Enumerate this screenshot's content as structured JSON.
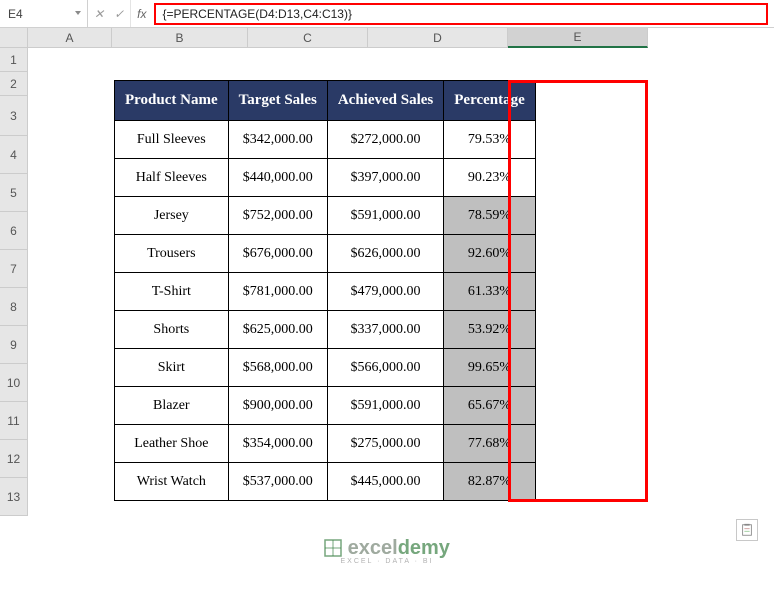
{
  "formula_bar": {
    "cell_ref": "E4",
    "formula": "{=PERCENTAGE(D4:D13,C4:C13)}"
  },
  "columns": [
    "A",
    "B",
    "C",
    "D",
    "E"
  ],
  "rows": [
    "1",
    "2",
    "3",
    "4",
    "5",
    "6",
    "7",
    "8",
    "9",
    "10",
    "11",
    "12",
    "13"
  ],
  "headers": {
    "product": "Product Name",
    "target": "Target Sales",
    "achieved": "Achieved Sales",
    "percentage": "Percentage"
  },
  "data": [
    {
      "product": "Full Sleeves",
      "target": "$342,000.00",
      "achieved": "$272,000.00",
      "pct": "79.53%"
    },
    {
      "product": "Half Sleeves",
      "target": "$440,000.00",
      "achieved": "$397,000.00",
      "pct": "90.23%"
    },
    {
      "product": "Jersey",
      "target": "$752,000.00",
      "achieved": "$591,000.00",
      "pct": "78.59%"
    },
    {
      "product": "Trousers",
      "target": "$676,000.00",
      "achieved": "$626,000.00",
      "pct": "92.60%"
    },
    {
      "product": "T-Shirt",
      "target": "$781,000.00",
      "achieved": "$479,000.00",
      "pct": "61.33%"
    },
    {
      "product": "Shorts",
      "target": "$625,000.00",
      "achieved": "$337,000.00",
      "pct": "53.92%"
    },
    {
      "product": "Skirt",
      "target": "$568,000.00",
      "achieved": "$566,000.00",
      "pct": "99.65%"
    },
    {
      "product": "Blazer",
      "target": "$900,000.00",
      "achieved": "$591,000.00",
      "pct": "65.67%"
    },
    {
      "product": "Leather Shoe",
      "target": "$354,000.00",
      "achieved": "$275,000.00",
      "pct": "77.68%"
    },
    {
      "product": "Wrist Watch",
      "target": "$537,000.00",
      "achieved": "$445,000.00",
      "pct": "82.87%"
    }
  ],
  "watermark": {
    "brand_a": "excel",
    "brand_b": "demy",
    "tagline": "EXCEL · DATA · BI"
  },
  "chart_data": {
    "type": "table",
    "columns": [
      "Product Name",
      "Target Sales",
      "Achieved Sales",
      "Percentage"
    ],
    "rows": [
      [
        "Full Sleeves",
        342000,
        272000,
        0.7953
      ],
      [
        "Half Sleeves",
        440000,
        397000,
        0.9023
      ],
      [
        "Jersey",
        752000,
        591000,
        0.7859
      ],
      [
        "Trousers",
        676000,
        626000,
        0.926
      ],
      [
        "T-Shirt",
        781000,
        479000,
        0.6133
      ],
      [
        "Shorts",
        625000,
        337000,
        0.5392
      ],
      [
        "Skirt",
        568000,
        566000,
        0.9965
      ],
      [
        "Blazer",
        900000,
        591000,
        0.6567
      ],
      [
        "Leather Shoe",
        354000,
        275000,
        0.7768
      ],
      [
        "Wrist Watch",
        537000,
        445000,
        0.8287
      ]
    ]
  }
}
